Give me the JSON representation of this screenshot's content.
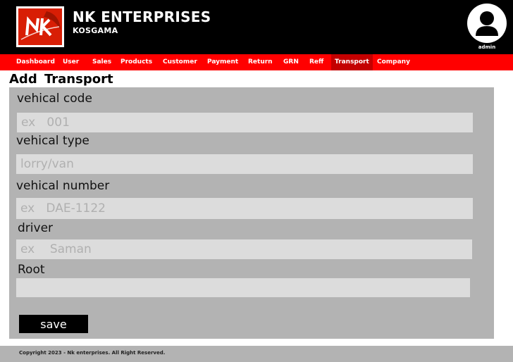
{
  "header": {
    "logo_text": "NK",
    "company_name": "NK ENTERPRISES",
    "location": "KOSGAMA",
    "user_name": "admin"
  },
  "nav": {
    "items": [
      {
        "label": "Dashboard"
      },
      {
        "label": "User"
      },
      {
        "label": "Sales"
      },
      {
        "label": "Products"
      },
      {
        "label": "Customer"
      },
      {
        "label": "Payment"
      },
      {
        "label": "Return"
      },
      {
        "label": "GRN"
      },
      {
        "label": "Reff"
      },
      {
        "label": "Transport"
      },
      {
        "label": "Company"
      }
    ],
    "active": "Transport"
  },
  "page": {
    "title": "Add  Transport"
  },
  "form": {
    "vehicle_code": {
      "label": "vehical code",
      "placeholder": "ex   001",
      "value": ""
    },
    "vehicle_type": {
      "label": "vehical type",
      "placeholder": "lorry/van",
      "value": ""
    },
    "vehicle_number": {
      "label": "vehical number",
      "placeholder": "ex   DAE-1122",
      "value": ""
    },
    "driver": {
      "label": "driver",
      "placeholder": "ex    Saman",
      "value": ""
    },
    "root": {
      "label": "Root",
      "placeholder": "",
      "value": ""
    },
    "save_label": "save"
  },
  "footer": {
    "text": "Copyright 2023 - Nk enterprises. All Right Reserved."
  },
  "colors": {
    "header_bg": "#000000",
    "nav_bg": "#ff0000",
    "nav_active_bg": "#c40000",
    "form_bg": "#b3b3b3",
    "field_bg": "#dcdcdc",
    "logo_red": "#d81e05"
  },
  "icons": {
    "logo": "nk-logo-icon",
    "user": "user-avatar-icon"
  }
}
